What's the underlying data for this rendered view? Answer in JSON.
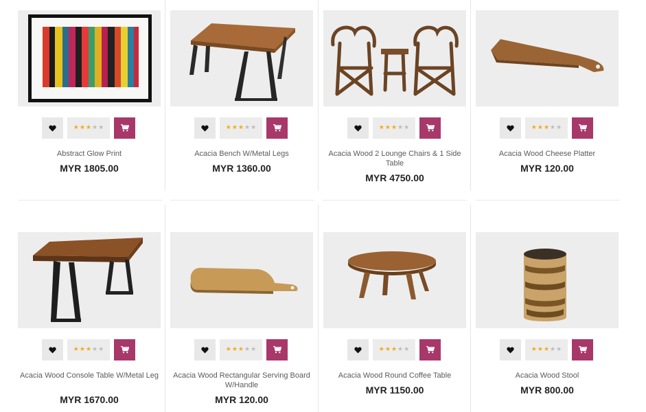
{
  "colors": {
    "accent": "#a8386a",
    "star": "#f0ad1a",
    "star_off": "#bdbdbd",
    "button_bg": "#e8e8e8"
  },
  "icons": {
    "wishlist": "heart-icon",
    "cart": "cart-icon",
    "star": "star-icon"
  },
  "products": [
    {
      "title": "Abstract Glow Print",
      "price": "MYR 1805.00",
      "rating": 3,
      "max_rating": 5
    },
    {
      "title": "Acacia Bench W/Metal Legs",
      "price": "MYR 1360.00",
      "rating": 3,
      "max_rating": 5
    },
    {
      "title": "Acacia Wood 2 Lounge Chairs & 1 Side Table",
      "price": "MYR 4750.00",
      "rating": 3,
      "max_rating": 5
    },
    {
      "title": "Acacia Wood Cheese Platter",
      "price": "MYR 120.00",
      "rating": 3,
      "max_rating": 5
    },
    {
      "title": "Acacia Wood Console Table W/Metal Leg",
      "price": "MYR 1670.00",
      "rating": 3,
      "max_rating": 5
    },
    {
      "title": "Acacia Wood Rectangular Serving Board W/Handle",
      "price": "MYR 120.00",
      "rating": 3,
      "max_rating": 5
    },
    {
      "title": "Acacia Wood Round Coffee Table",
      "price": "MYR 1150.00",
      "rating": 3,
      "max_rating": 5
    },
    {
      "title": "Acacia Wood Stool",
      "price": "MYR 800.00",
      "rating": 3,
      "max_rating": 5
    }
  ]
}
